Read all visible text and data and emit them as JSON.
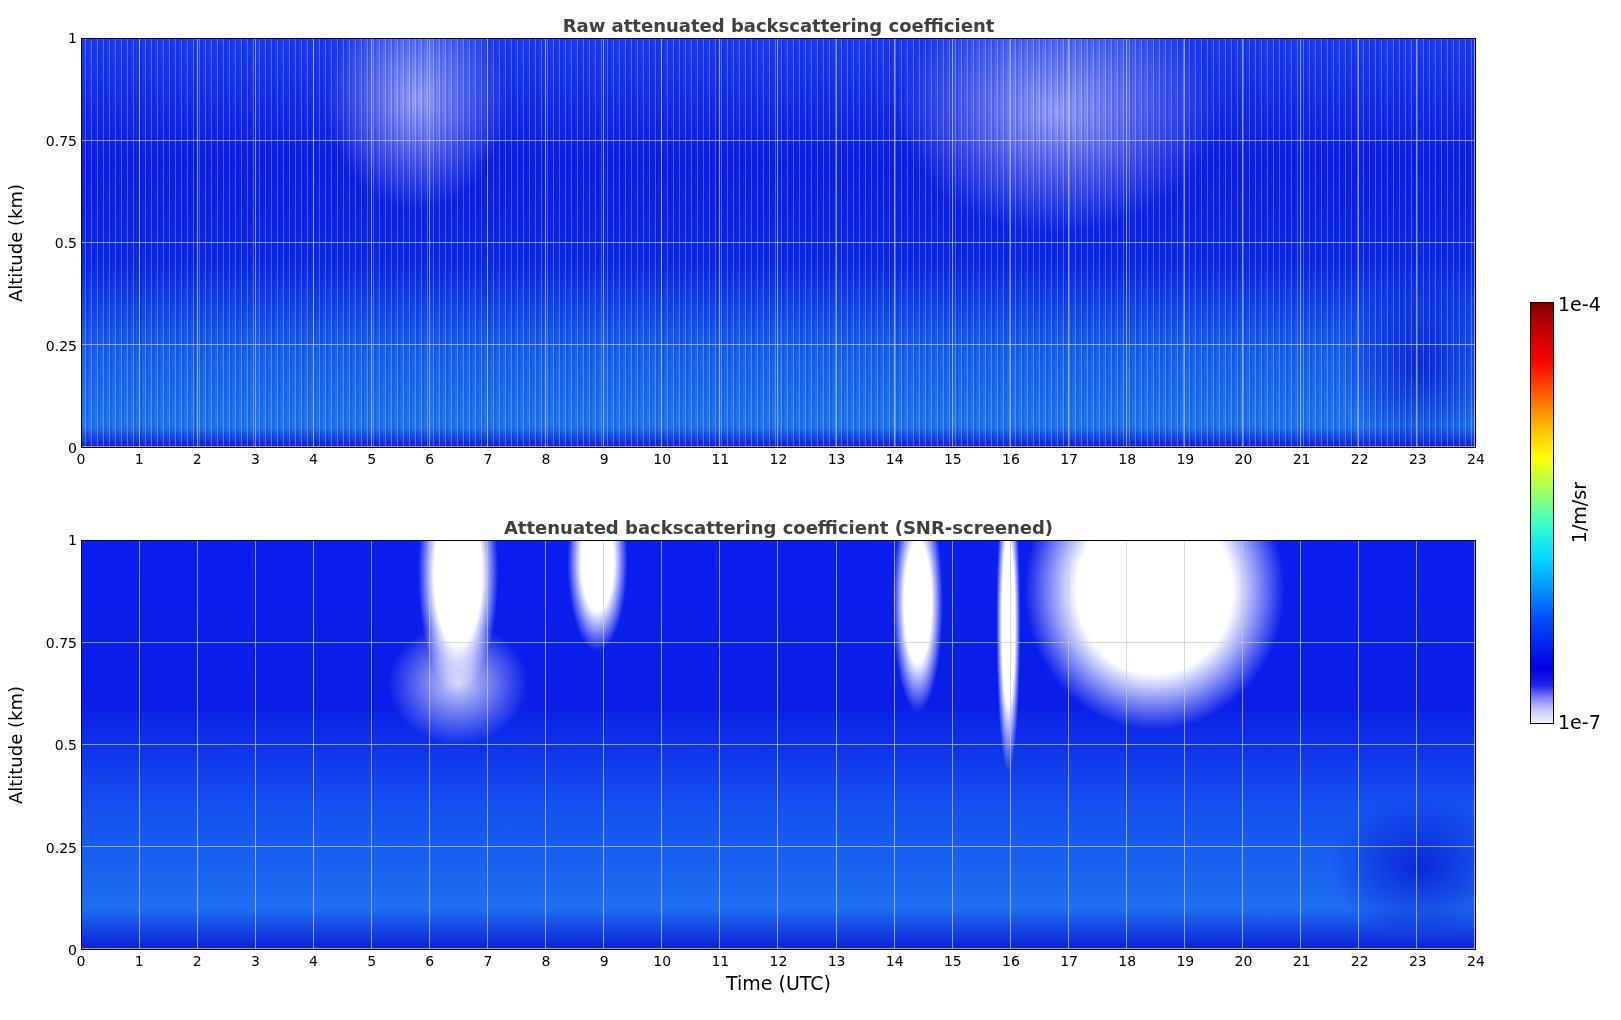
{
  "panels": [
    {
      "kind": "raw",
      "title": "Raw attenuated backscattering coefficient",
      "ylabel": "Altitude (km)",
      "yticks": [
        "1",
        "0.75",
        "0.5",
        "0.25",
        "0"
      ],
      "xticks": [
        "0",
        "1",
        "2",
        "3",
        "4",
        "5",
        "6",
        "7",
        "8",
        "9",
        "10",
        "11",
        "12",
        "13",
        "14",
        "15",
        "16",
        "17",
        "18",
        "19",
        "20",
        "21",
        "22",
        "23",
        "24"
      ]
    },
    {
      "kind": "screened",
      "title": "Attenuated backscattering coefficient (SNR-screened)",
      "ylabel": "Altitude (km)",
      "yticks": [
        "1",
        "0.75",
        "0.5",
        "0.25",
        "0"
      ],
      "xticks": [
        "0",
        "1",
        "2",
        "3",
        "4",
        "5",
        "6",
        "7",
        "8",
        "9",
        "10",
        "11",
        "12",
        "13",
        "14",
        "15",
        "16",
        "17",
        "18",
        "19",
        "20",
        "21",
        "22",
        "23",
        "24"
      ]
    }
  ],
  "xlabel": "Time (UTC)",
  "colorbar": {
    "max_label": "1e-4",
    "min_label": "1e-7",
    "unit": "1/m/sr"
  }
}
